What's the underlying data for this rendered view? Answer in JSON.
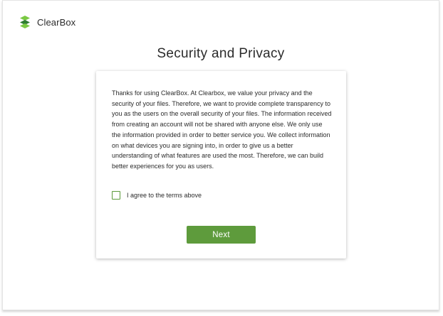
{
  "app": {
    "logo_icon": "clearbox-logo-icon",
    "name": "ClearBox"
  },
  "page": {
    "title": "Security and Privacy"
  },
  "card": {
    "body": "Thanks for using ClearBox. At Clearbox, we value your privacy and the security of your files. Therefore, we want to provide complete transparency to you as the users on the overall security of your files. The information received from creating an account will not be shared with anyone else. We only use the information provided in order to better service you. We collect information on what devices you are signing into, in order to give us a better understanding of what features are used the most. Therefore, we can build better experiences for you as users.",
    "agree_checked": false,
    "agree_label": "I agree to the terms above",
    "next_label": "Next"
  },
  "colors": {
    "accent": "#5e9b3c",
    "logo_dark": "#2e7d32",
    "logo_light": "#7ac943"
  }
}
